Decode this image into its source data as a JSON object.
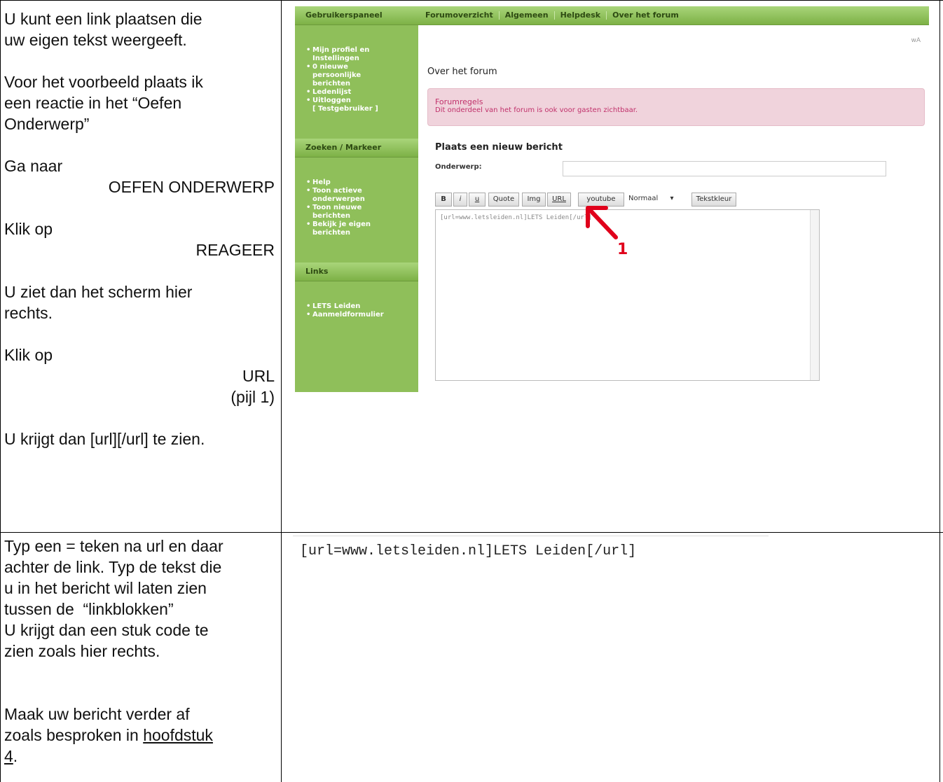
{
  "left_top": {
    "p1": [
      "U kunt een link plaatsen die",
      "uw eigen tekst weergeeft."
    ],
    "p2": [
      "Voor het voorbeeld plaats ik",
      "een reactie in het “Oefen",
      "Onderwerp”"
    ],
    "p3": [
      "Ga naar"
    ],
    "p3_target": "OEFEN ONDERWERP",
    "p4": [
      "Klik op"
    ],
    "p4_target": "REAGEER",
    "p5": [
      "U ziet dan het scherm hier",
      "rechts."
    ],
    "p6": [
      "Klik op"
    ],
    "p6_target": "URL",
    "p6_note": "(pijl 1)",
    "p7": "U krijgt dan [url][/url] te zien."
  },
  "left_bottom": {
    "lines": [
      "Typ een = teken na url en daar",
      "achter de link. Typ de tekst die",
      "u in het bericht wil laten zien",
      "tussen de  “linkblokken”",
      "U krijgt dan een stuk code te",
      "zien zoals hier rechts."
    ],
    "p2a": "Maak uw bericht verder af",
    "p2b": "zoals besproken in ",
    "p2_link": "hoofdstuk",
    "p2_link2": "4",
    "p2_end": "."
  },
  "forum": {
    "sidebar_head1": "Gebruikerspaneel",
    "menu1": [
      "Mijn profiel en",
      "Instellingen",
      "0 nieuwe",
      "persoonlijke",
      "berichten",
      "Ledenlijst",
      "Uitloggen"
    ],
    "menu1_user": "[ Testgebruiker ]",
    "sidebar_head2": "Zoeken / Markeer",
    "menu2": [
      "Help",
      "Toon actieve",
      "onderwerpen",
      "Toon nieuwe",
      "berichten",
      "Bekijk je eigen",
      "berichten"
    ],
    "sidebar_head3": "Links",
    "menu3": [
      "LETS Leiden",
      "Aanmeldformulier"
    ],
    "nav": [
      "Forumoverzicht",
      "Algemeen",
      "Helpdesk",
      "Over het forum"
    ],
    "page_title": "Over het forum",
    "rules_title": "Forumregels",
    "rules_text": "Dit onderdeel van het forum is ook voor gasten zichtbaar.",
    "form_title": "Plaats een nieuw bericht",
    "subject_label": "Onderwerp:",
    "toolbar": [
      "B",
      "i",
      "u",
      "Quote",
      "Img",
      "URL",
      "youtube",
      "Normaal",
      "Tekstkleur"
    ],
    "editor_text": "[url=www.letsleiden.nl]LETS Leiden[/url]",
    "arrow_label": "1"
  },
  "code_sample": "[url=www.letsleiden.nl]LETS Leiden[/url]"
}
